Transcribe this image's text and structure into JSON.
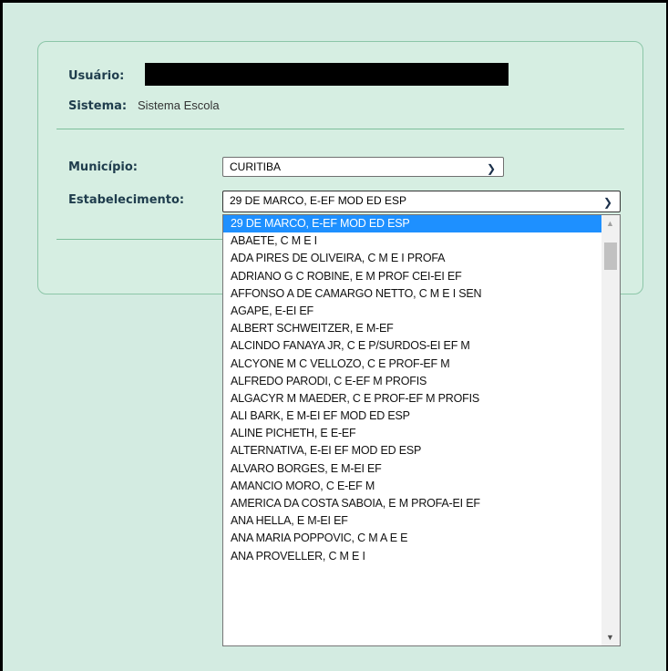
{
  "user_label": "Usuário:",
  "system_label": "Sistema:",
  "system_value": "Sistema Escola",
  "municipio_label": "Município:",
  "municipio_value": "CURITIBA",
  "estab_label": "Estabelecimento:",
  "estab_value": "29 DE MARCO, E-EF MOD ED ESP",
  "options": [
    "29 DE MARCO, E-EF MOD ED ESP",
    "ABAETE, C M E I",
    "ADA PIRES DE OLIVEIRA, C M E I PROFA",
    "ADRIANO G C ROBINE, E M PROF CEI-EI EF",
    "AFFONSO A DE CAMARGO NETTO, C M E I SEN",
    "AGAPE, E-EI EF",
    "ALBERT SCHWEITZER, E M-EF",
    "ALCINDO FANAYA JR, C E P/SURDOS-EI EF M",
    "ALCYONE M C VELLOZO, C E PROF-EF M",
    "ALFREDO PARODI, C E-EF M PROFIS",
    "ALGACYR M MAEDER, C E PROF-EF M PROFIS",
    "ALI BARK, E M-EI EF MOD ED ESP",
    "ALINE PICHETH, E E-EF",
    "ALTERNATIVA, E-EI EF MOD ED ESP",
    "ALVARO BORGES, E M-EI EF",
    "AMANCIO MORO, C E-EF M",
    "AMERICA DA COSTA SABOIA, E M PROFA-EI EF",
    "ANA HELLA, E M-EI EF",
    "ANA MARIA POPPOVIC, C M A E E",
    "ANA PROVELLER, C M E I"
  ]
}
